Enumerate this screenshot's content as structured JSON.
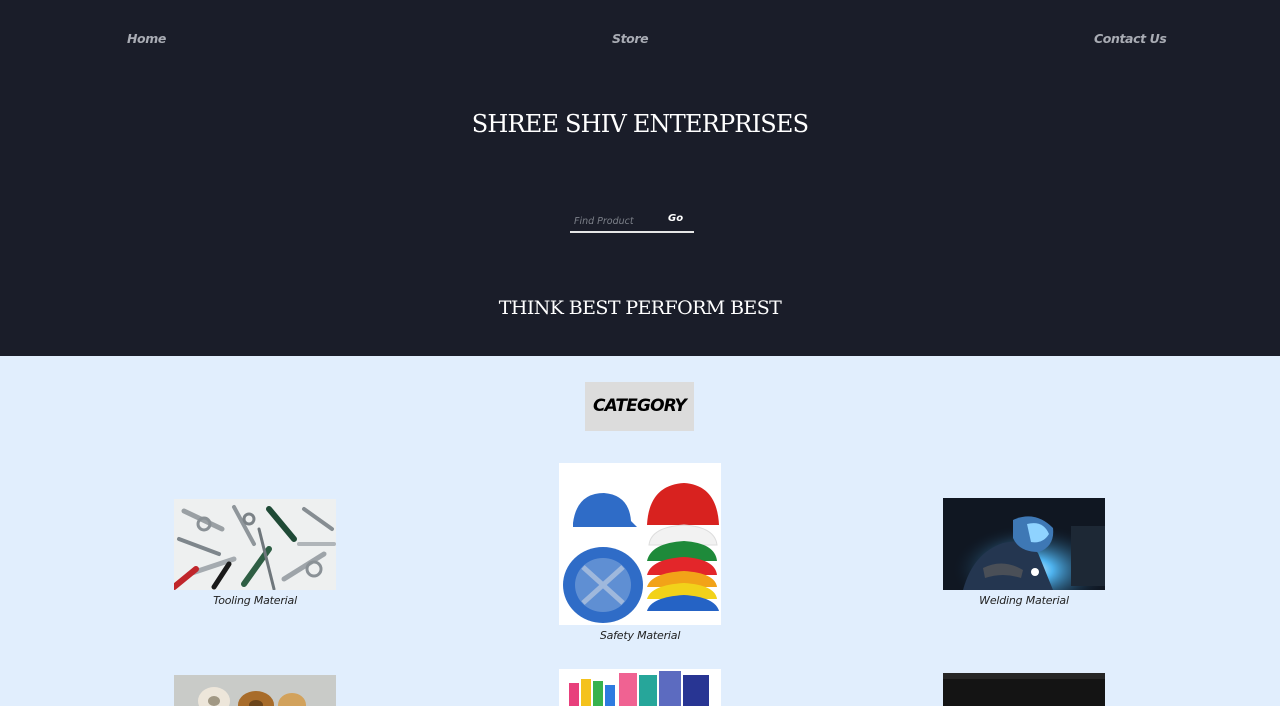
{
  "nav": {
    "home": "Home",
    "store": "Store",
    "contact": "Contact Us"
  },
  "header": {
    "title": "SHREE SHIV ENTERPRISES",
    "tagline": "THINK BEST PERFORM BEST"
  },
  "search": {
    "placeholder": "Find Product",
    "value": "",
    "button_label": "Go"
  },
  "category": {
    "heading": "CATEGORY",
    "items": [
      {
        "label": "Tooling Material",
        "image": "tools-image"
      },
      {
        "label": "Safety Material",
        "image": "safety-helmets-image"
      },
      {
        "label": "Welding Material",
        "image": "welder-image"
      },
      {
        "label": "",
        "image": "tape-rolls-image"
      },
      {
        "label": "",
        "image": "stationery-image"
      },
      {
        "label": "",
        "image": "dark-product-image"
      }
    ]
  },
  "colors": {
    "hero_background": "#1a1d29",
    "page_background": "#e1eefd",
    "category_heading_background": "#dcdcdc"
  }
}
